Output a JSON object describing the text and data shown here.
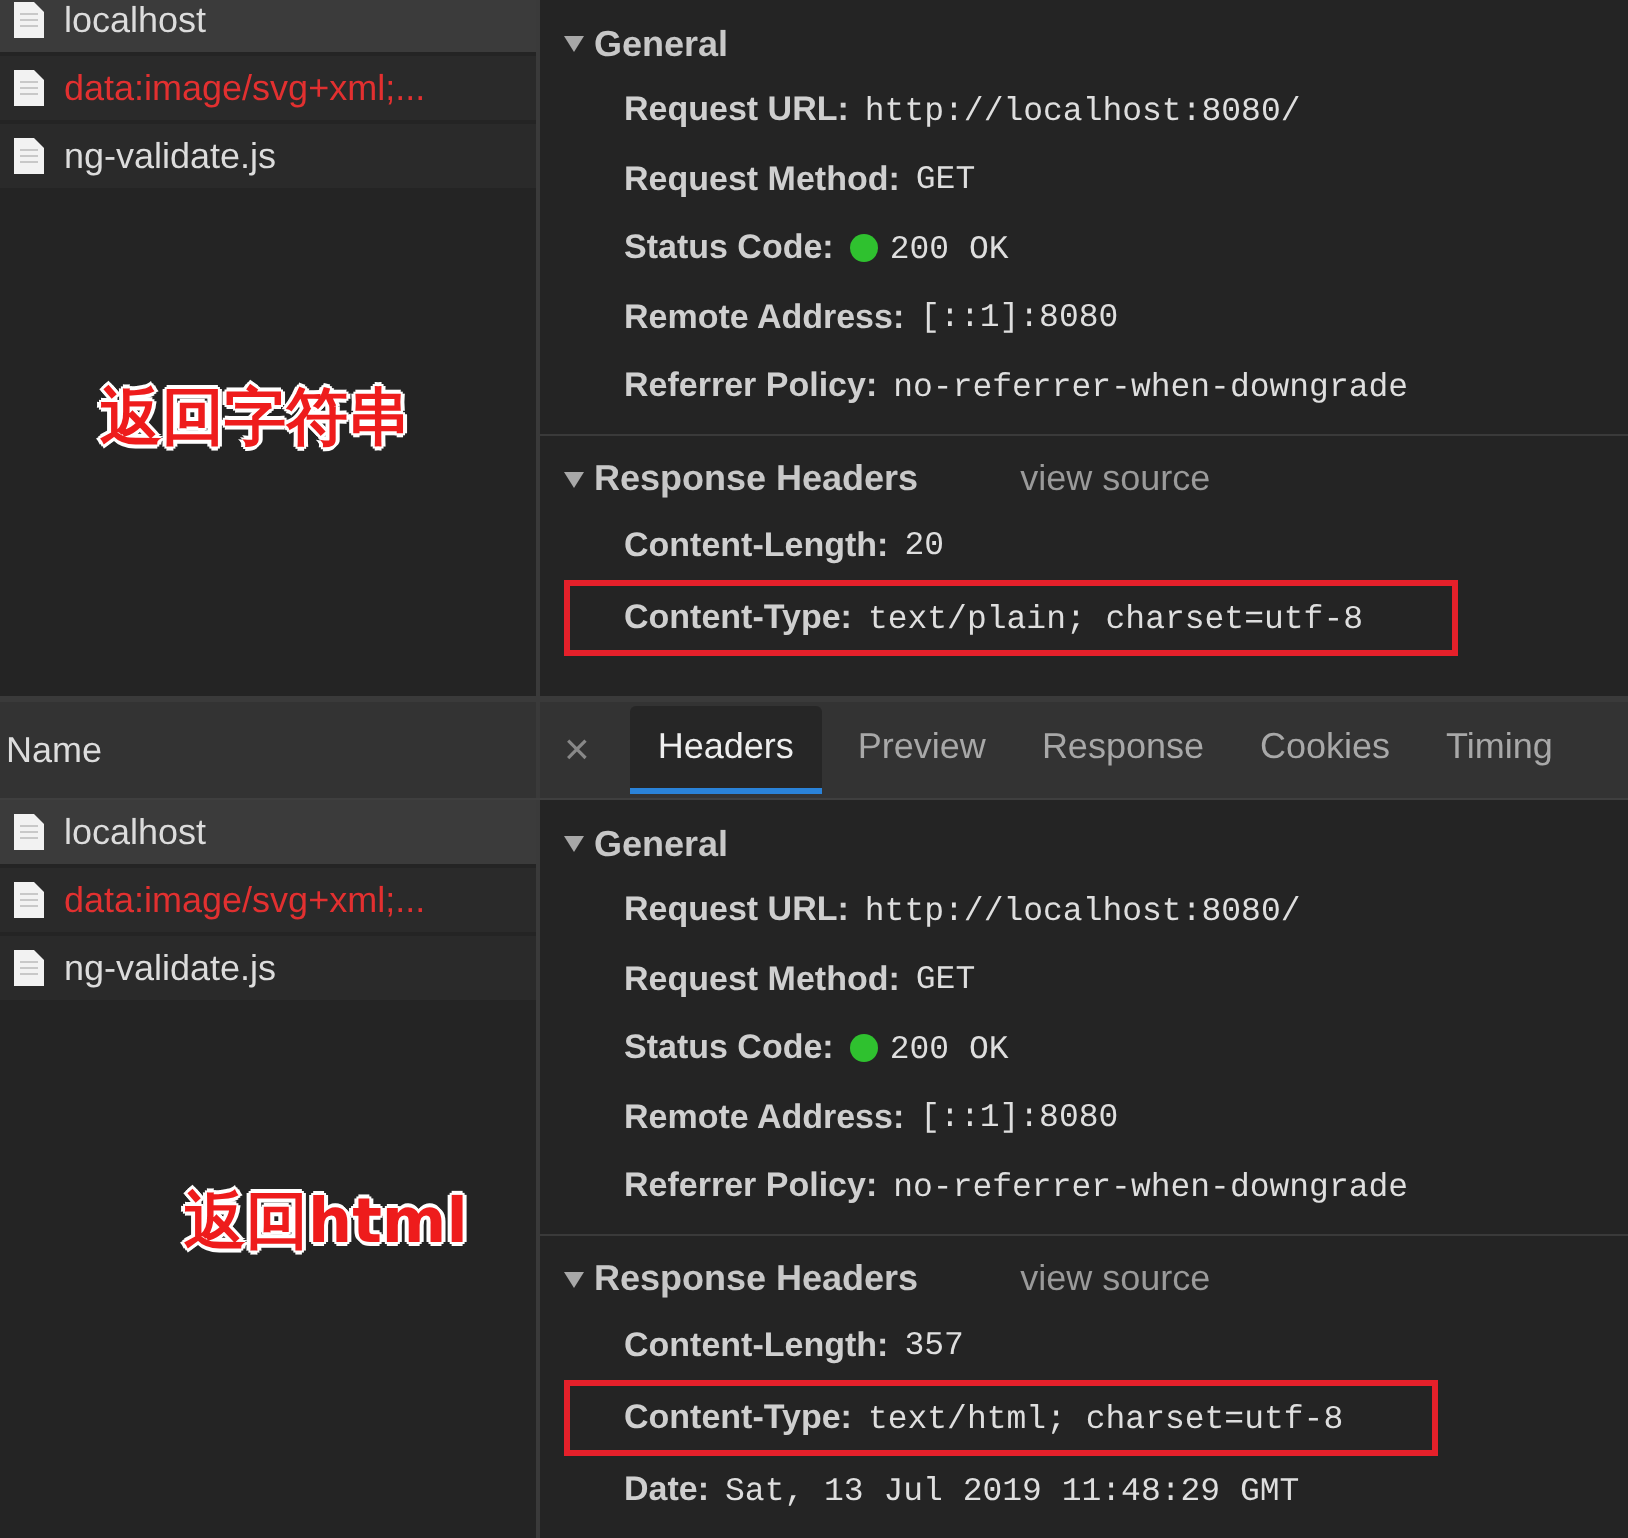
{
  "panels": [
    {
      "annotation": "返回字符串",
      "requests": [
        {
          "name": "localhost",
          "selected": true,
          "error": false
        },
        {
          "name": "data:image/svg+xml;...",
          "selected": false,
          "error": true
        },
        {
          "name": "ng-validate.js",
          "selected": false,
          "error": false
        }
      ],
      "sections": [
        {
          "title": "General",
          "expanded": true,
          "rows": [
            {
              "label": "Request URL:",
              "value": "http://localhost:8080/",
              "kind": "plain",
              "highlighted": false
            },
            {
              "label": "Request Method:",
              "value": "GET",
              "kind": "plain",
              "highlighted": false
            },
            {
              "label": "Status Code:",
              "value": "200 OK",
              "kind": "status",
              "color": "#2fc12f",
              "highlighted": false
            },
            {
              "label": "Remote Address:",
              "value": "[::1]:8080",
              "kind": "plain",
              "highlighted": false
            },
            {
              "label": "Referrer Policy:",
              "value": "no-referrer-when-downgrade",
              "kind": "plain",
              "highlighted": false
            }
          ]
        },
        {
          "title": "Response Headers",
          "link": "view source",
          "expanded": true,
          "rows": [
            {
              "label": "Content-Length:",
              "value": "20",
              "kind": "plain",
              "highlighted": false
            },
            {
              "label": "Content-Type:",
              "value": "text/plain; charset=utf-8",
              "kind": "plain",
              "highlighted": true
            }
          ]
        }
      ]
    },
    {
      "annotation": "返回html",
      "name_header": "Name",
      "close": "×",
      "tabs": [
        {
          "label": "Headers",
          "selected": true
        },
        {
          "label": "Preview",
          "selected": false
        },
        {
          "label": "Response",
          "selected": false
        },
        {
          "label": "Cookies",
          "selected": false
        },
        {
          "label": "Timing",
          "selected": false
        }
      ],
      "requests": [
        {
          "name": "localhost",
          "selected": true,
          "error": false
        },
        {
          "name": "data:image/svg+xml;...",
          "selected": false,
          "error": true
        },
        {
          "name": "ng-validate.js",
          "selected": false,
          "error": false
        }
      ],
      "sections": [
        {
          "title": "General",
          "expanded": true,
          "rows": [
            {
              "label": "Request URL:",
              "value": "http://localhost:8080/",
              "kind": "plain",
              "highlighted": false
            },
            {
              "label": "Request Method:",
              "value": "GET",
              "kind": "plain",
              "highlighted": false
            },
            {
              "label": "Status Code:",
              "value": "200 OK",
              "kind": "status",
              "color": "#2fc12f",
              "highlighted": false
            },
            {
              "label": "Remote Address:",
              "value": "[::1]:8080",
              "kind": "plain",
              "highlighted": false
            },
            {
              "label": "Referrer Policy:",
              "value": "no-referrer-when-downgrade",
              "kind": "plain",
              "highlighted": false
            }
          ]
        },
        {
          "title": "Response Headers",
          "link": "view source",
          "expanded": true,
          "rows": [
            {
              "label": "Content-Length:",
              "value": "357",
              "kind": "plain",
              "highlighted": false
            },
            {
              "label": "Content-Type:",
              "value": "text/html; charset=utf-8",
              "kind": "plain",
              "highlighted": true
            },
            {
              "label": "Date:",
              "value": "Sat, 13 Jul 2019 11:48:29 GMT",
              "kind": "plain",
              "highlighted": false
            }
          ]
        }
      ]
    }
  ]
}
